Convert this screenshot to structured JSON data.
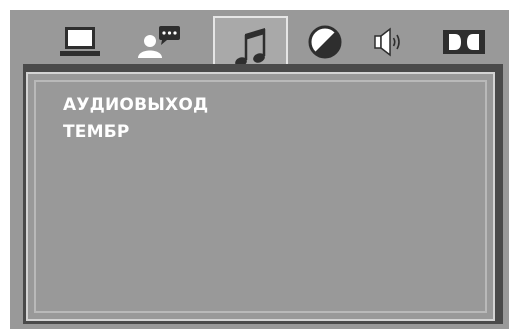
{
  "tabs": [
    {
      "icon": "monitor-icon",
      "active": false
    },
    {
      "icon": "person-speech-icon",
      "active": false
    },
    {
      "icon": "music-note-icon",
      "active": true
    },
    {
      "icon": "contrast-circle-icon",
      "active": false
    },
    {
      "icon": "speaker-icon",
      "active": false
    },
    {
      "icon": "dolby-icon",
      "active": false
    }
  ],
  "menu": {
    "items": [
      "АУДИОВЫХОД",
      "ТЕМБР"
    ]
  },
  "colors": {
    "background": "#999999",
    "panel_dark": "#4a4a4a",
    "frame_light": "#d4d4d4",
    "text": "#ffffff",
    "icon_dark": "#2e2e2e"
  }
}
